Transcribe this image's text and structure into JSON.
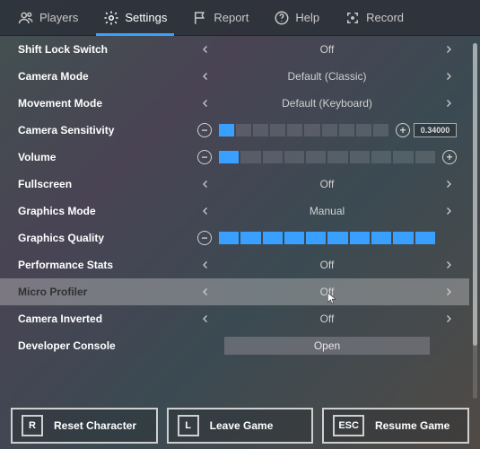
{
  "tabs": {
    "players": "Players",
    "settings": "Settings",
    "report": "Report",
    "help": "Help",
    "record": "Record"
  },
  "active_tab": "settings",
  "settings": {
    "shift_lock": {
      "label": "Shift Lock Switch",
      "value": "Off"
    },
    "camera_mode": {
      "label": "Camera Mode",
      "value": "Default (Classic)"
    },
    "movement_mode": {
      "label": "Movement Mode",
      "value": "Default (Keyboard)"
    },
    "camera_sensitivity": {
      "label": "Camera Sensitivity",
      "value_text": "0.34000",
      "filled": 1,
      "total": 10
    },
    "volume": {
      "label": "Volume",
      "filled": 1,
      "total": 10
    },
    "fullscreen": {
      "label": "Fullscreen",
      "value": "Off"
    },
    "graphics_mode": {
      "label": "Graphics Mode",
      "value": "Manual"
    },
    "graphics_quality": {
      "label": "Graphics Quality",
      "filled": 10,
      "total": 10
    },
    "performance_stats": {
      "label": "Performance Stats",
      "value": "Off"
    },
    "micro_profiler": {
      "label": "Micro Profiler",
      "value": "Off"
    },
    "camera_inverted": {
      "label": "Camera Inverted",
      "value": "Off"
    },
    "developer_console": {
      "label": "Developer Console",
      "button": "Open"
    }
  },
  "highlighted_row": "micro_profiler",
  "bottom_buttons": {
    "reset": {
      "key": "R",
      "label": "Reset Character"
    },
    "leave": {
      "key": "L",
      "label": "Leave Game"
    },
    "resume": {
      "key": "ESC",
      "label": "Resume Game"
    }
  }
}
